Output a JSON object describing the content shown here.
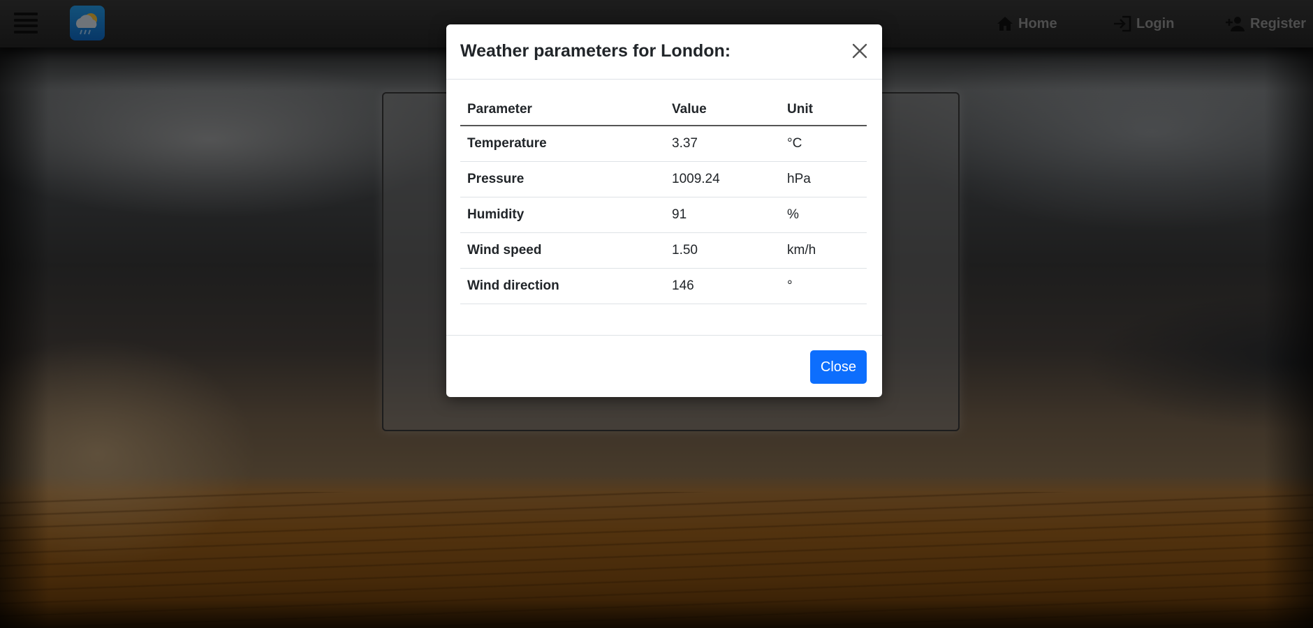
{
  "colors": {
    "navbar": "#2e2e2e",
    "nav_link": "#9a9a9a",
    "primary_button": "#0d6efd",
    "logo": "#1f8fe8"
  },
  "navbar": {
    "menu_icon": "hamburger-menu-icon",
    "logo_icon": "weather-cloud-sun-rain-icon",
    "links": [
      {
        "label": "Home",
        "icon": "home-icon"
      },
      {
        "label": "Login",
        "icon": "login-icon"
      },
      {
        "label": "Register",
        "icon": "add-user-icon"
      }
    ]
  },
  "modal": {
    "title_prefix": "Weather parameters for ",
    "city": "London",
    "title_suffix": ":",
    "close_icon": "close-icon",
    "table": {
      "headers": [
        "Parameter",
        "Value",
        "Unit"
      ],
      "rows": [
        [
          "Temperature",
          "3.37",
          "°C"
        ],
        [
          "Pressure",
          "1009.24",
          "hPa"
        ],
        [
          "Humidity",
          "91",
          "%"
        ],
        [
          "Wind speed",
          "1.50",
          "km/h"
        ],
        [
          "Wind direction",
          "146",
          "°"
        ]
      ]
    },
    "close_button_label": "Close"
  }
}
